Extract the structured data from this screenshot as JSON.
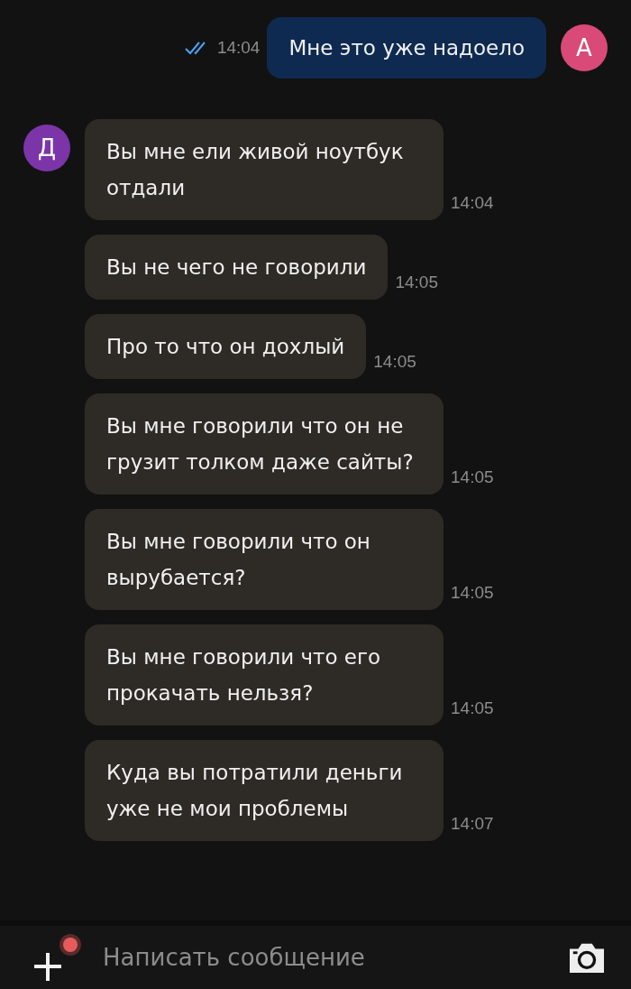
{
  "messages": [
    {
      "kind": "sent",
      "text": "Мне это уже надоело",
      "time": "14:04",
      "read": true,
      "avatar": "А"
    },
    {
      "kind": "received",
      "text": "Вы мне ели живой ноутбук отдали",
      "time": "14:04",
      "avatar": "Д"
    },
    {
      "kind": "received",
      "text": "Вы не чего не говорили",
      "time": "14:05"
    },
    {
      "kind": "received",
      "text": "Про то что он дохлый",
      "time": "14:05"
    },
    {
      "kind": "received",
      "text": "Вы мне говорили что он не грузит толком даже сайты?",
      "time": "14:05"
    },
    {
      "kind": "received",
      "text": "Вы мне говорили что он вырубается?",
      "time": "14:05"
    },
    {
      "kind": "received",
      "text": "Вы мне говорили что его прокачать нельзя?",
      "time": "14:05"
    },
    {
      "kind": "received",
      "text": "Куда вы потратили деньги уже не мои проблемы",
      "time": "14:07"
    }
  ],
  "composer": {
    "placeholder": "Написать сообщение",
    "attach_badge": true
  }
}
